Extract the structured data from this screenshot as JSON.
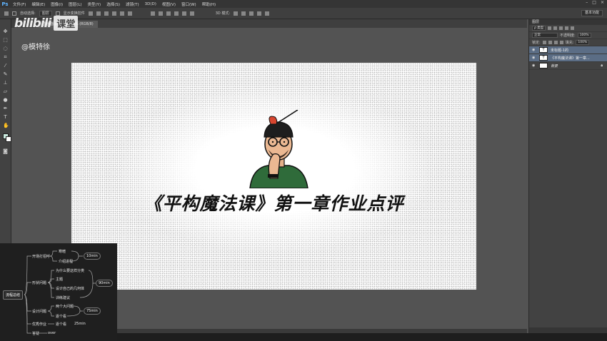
{
  "app": {
    "logo": "Ps",
    "menu": [
      "文件(F)",
      "编辑(E)",
      "图像(I)",
      "图层(L)",
      "类型(Y)",
      "选择(S)",
      "滤镜(T)",
      "3D(D)",
      "视图(V)",
      "窗口(W)",
      "帮助(H)"
    ],
    "workspace": "基本功能"
  },
  "options_bar": {
    "auto_select_label": "自动选择:",
    "auto_select_value": "图层",
    "transform_label": "显示变换控件",
    "mode_3d": "3D 模式:"
  },
  "document_tab": {
    "label": "主画面.psd @ 66.7% (RGB/8)"
  },
  "watermark": {
    "logo": "bilibili",
    "box": "课堂",
    "user": "@模特徐"
  },
  "canvas": {
    "headline": "《平构魔法课》第一章作业点评"
  },
  "layers_panel": {
    "title": "图层",
    "filter": "ρ 类型",
    "blend_mode": "正常",
    "opacity_label": "不透明度:",
    "opacity_value": "100%",
    "lock_label": "锁定:",
    "fill_label": "填充:",
    "fill_value": "100%",
    "layers": [
      {
        "name": "未标题-1的",
        "thumb": "T",
        "selected": true
      },
      {
        "name": "《平构魔法课》第一章...",
        "thumb": "T",
        "selected": true
      },
      {
        "name": "背景",
        "thumb": "",
        "selected": false
      }
    ]
  },
  "mindmap": {
    "root": "流程总结",
    "branches": [
      {
        "label": "开场打招呼",
        "children": [
          "寒暄",
          "介绍进程"
        ],
        "time": "10min"
      },
      {
        "label": "形状问题",
        "children": [
          "为什么要这样分类",
          "主题",
          "设计自己的几何体",
          "训练建议"
        ],
        "time": "90min"
      },
      {
        "label": "设计问题",
        "children": [
          "两个大问题",
          "逐个看"
        ],
        "time": "75min"
      },
      {
        "label": "优秀作业",
        "children": [
          "逐个看"
        ],
        "time": "25min"
      },
      {
        "label": "答疑",
        "children": [
          "over"
        ],
        "time": ""
      }
    ]
  }
}
